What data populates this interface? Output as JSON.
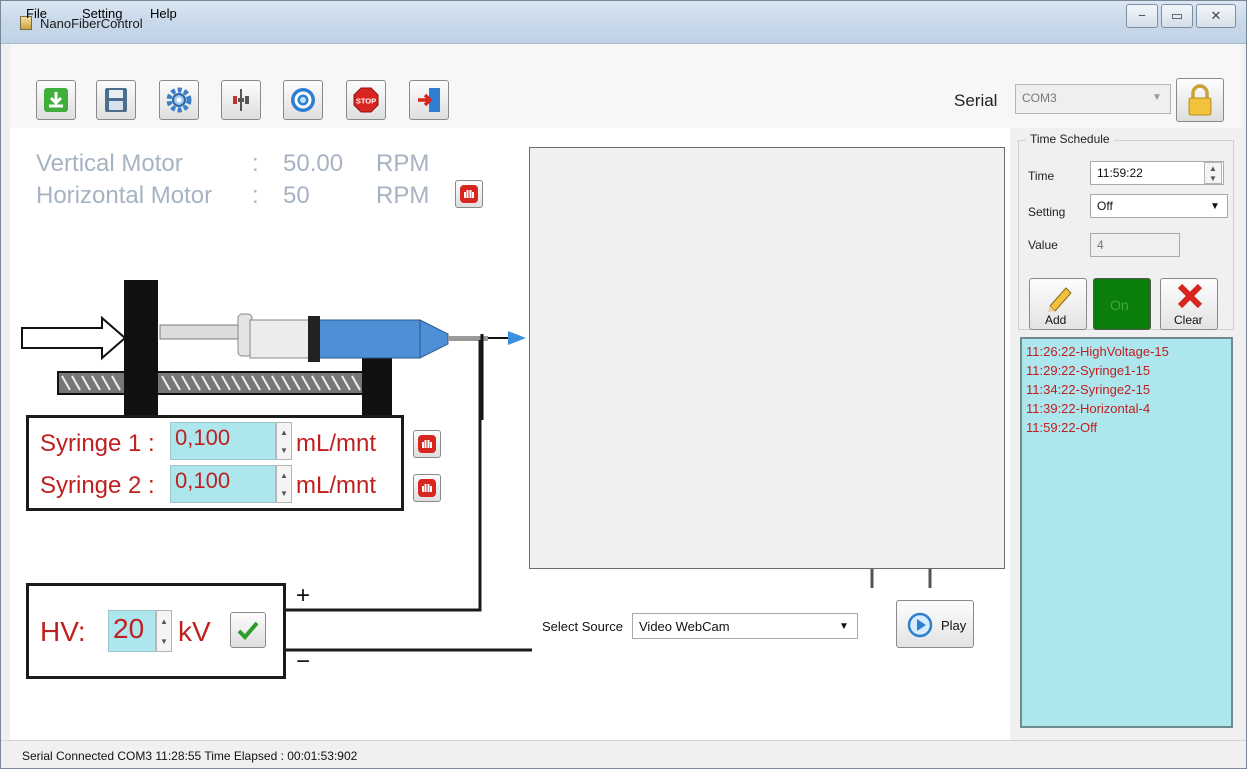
{
  "window": {
    "title": "NanoFiberControl",
    "minimize": "−",
    "maximize": "▭",
    "close": "✕"
  },
  "menu": [
    "File",
    "Setting",
    "Help"
  ],
  "toolbar": {
    "buttons": [
      "download-icon",
      "save-icon",
      "settings-gear-icon",
      "pump-icon",
      "target-icon",
      "stop-sign-icon",
      "exit-door-icon"
    ],
    "stop_text": "STOP",
    "serial_label": "Serial",
    "serial_port": "COM3"
  },
  "motors": {
    "vertical_label": "Vertical Motor",
    "vertical_sep": ":",
    "vertical_value": "50.00",
    "vertical_unit": "RPM",
    "horizontal_label": "Horizontal Motor",
    "horizontal_sep": ":",
    "horizontal_value": "50",
    "horizontal_unit": "RPM"
  },
  "syringes": [
    {
      "label": "Syringe 1 :",
      "value": "0,100",
      "unit": "mL/mnt"
    },
    {
      "label": "Syringe 2 :",
      "value": "0,100",
      "unit": "mL/mnt"
    }
  ],
  "hv": {
    "label": "HV:",
    "value": "20",
    "unit": "kV",
    "plus": "+",
    "minus": "−"
  },
  "video": {
    "select_source_label": "Select Source",
    "source_value": "Video WebCam",
    "play_label": "Play"
  },
  "schedule": {
    "group_title": "Time Schedule",
    "time_label": "Time",
    "time_value": "11:59:22",
    "setting_label": "Setting",
    "setting_value": "Off",
    "value_label": "Value",
    "value_value": "4",
    "add_label": "Add",
    "on_label": "On",
    "clear_label": "Clear",
    "entries": [
      "11:26:22-HighVoltage-15",
      "11:29:22-Syringe1-15",
      "11:34:22-Syringe2-15",
      "11:39:22-Horizontal-4",
      "11:59:22-Off"
    ]
  },
  "status": {
    "text": "Serial Connected COM3  11:28:55  Time Elapsed : 00:01:53:902"
  },
  "colors": {
    "accent_red": "#c01f1f",
    "cyan_field": "#aee6ee",
    "on_green": "#0b7d0b",
    "motor_text": "#a7b3c3"
  }
}
